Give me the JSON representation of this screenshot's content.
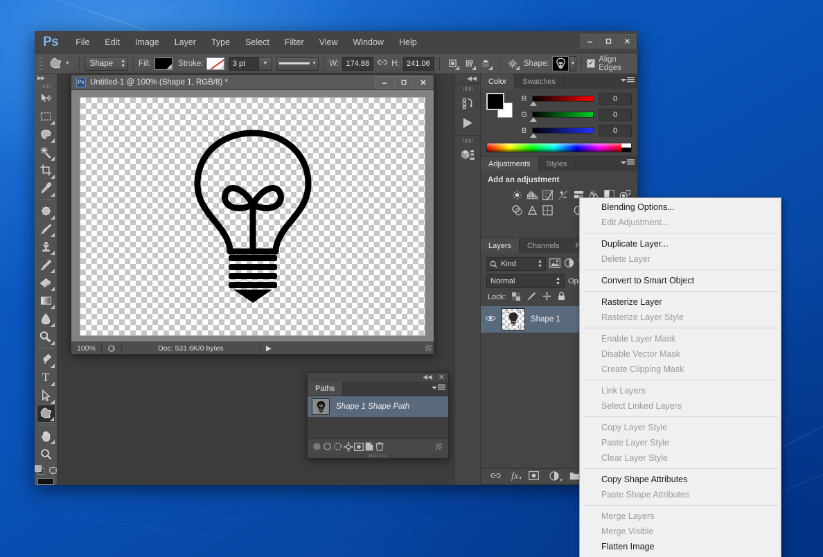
{
  "app": {
    "logo": "Ps",
    "menus": [
      "File",
      "Edit",
      "Image",
      "Layer",
      "Type",
      "Select",
      "Filter",
      "View",
      "Window",
      "Help"
    ],
    "window_controls": {
      "minimize": "–",
      "maximize": "☐",
      "close": "✕"
    }
  },
  "options_bar": {
    "tool_icon": "custom-shape-icon",
    "mode_value": "Shape",
    "fill_label": "Fill:",
    "fill_color": "#000000",
    "stroke_label": "Stroke:",
    "stroke_color": "none",
    "stroke_width": "3 pt",
    "line_style": "solid-line",
    "w_label": "W:",
    "w_value": "174.88 ",
    "link_icon": "link-icon",
    "h_label": "H:",
    "h_value": "241.06 ",
    "path_ops_icon": "path-operations-icon",
    "path_align_icon": "path-alignment-icon",
    "path_arrange_icon": "path-arrangement-icon",
    "gear_icon": "gear-icon",
    "shape_label": "Shape:",
    "shape_preview": "lightbulb-icon",
    "align_edges_label": "Align Edges",
    "align_edges_checked": true
  },
  "toolbox": {
    "tools": [
      {
        "name": "move-tool",
        "glyph": "move"
      },
      {
        "name": "rectangular-marquee-tool",
        "glyph": "marquee"
      },
      {
        "name": "lasso-tool",
        "glyph": "lasso"
      },
      {
        "name": "quick-selection-tool",
        "glyph": "wand"
      },
      {
        "name": "crop-tool",
        "glyph": "crop"
      },
      {
        "name": "eyedropper-tool",
        "glyph": "eyedropper"
      },
      {
        "name": "spot-healing-brush-tool",
        "glyph": "healing"
      },
      {
        "name": "brush-tool",
        "glyph": "brush"
      },
      {
        "name": "clone-stamp-tool",
        "glyph": "stamp"
      },
      {
        "name": "history-brush-tool",
        "glyph": "historybrush"
      },
      {
        "name": "eraser-tool",
        "glyph": "eraser"
      },
      {
        "name": "gradient-tool",
        "glyph": "gradient"
      },
      {
        "name": "blur-tool",
        "glyph": "blur"
      },
      {
        "name": "dodge-tool",
        "glyph": "dodge"
      },
      {
        "name": "pen-tool",
        "glyph": "pen"
      },
      {
        "name": "horizontal-type-tool",
        "glyph": "type"
      },
      {
        "name": "path-selection-tool",
        "glyph": "pathselect"
      },
      {
        "name": "custom-shape-tool",
        "glyph": "customshape",
        "active": true
      },
      {
        "name": "hand-tool",
        "glyph": "hand"
      },
      {
        "name": "zoom-tool",
        "glyph": "zoom"
      }
    ],
    "foreground_color": "#000000",
    "background_color": "#ffffff"
  },
  "document": {
    "title": "Untitled-1 @ 100% (Shape 1, RGB/8) *",
    "icon": "ps-document-icon",
    "controls": {
      "minimize": "–",
      "maximize": "☐",
      "close": "✕"
    },
    "artwork": "lightbulb-shape",
    "status": {
      "zoom": "100%",
      "doc_icon": "document-info-icon",
      "doc_size": "Doc: 531.6K/0 bytes",
      "arrow": "▶"
    }
  },
  "paths_panel": {
    "collapse_icon": "collapse-icon",
    "close_icon": "close-icon",
    "tabs": [
      {
        "label": "Paths",
        "active": true
      }
    ],
    "menu_icon": "panel-menu-icon",
    "rows": [
      {
        "name": "Shape 1 Shape Path",
        "thumb": "lightbulb-path-thumb",
        "selected": true
      }
    ],
    "footer_icons": [
      "fill-path-icon",
      "stroke-path-icon",
      "load-selection-icon",
      "make-work-path-icon",
      "add-layer-mask-icon",
      "new-path-icon",
      "delete-path-icon"
    ]
  },
  "mini_dock": {
    "collapse_icon": "collapse-dock-icon",
    "icons": [
      "history-icon",
      "actions-play-icon",
      "3d-icon"
    ]
  },
  "color_panel": {
    "tabs": [
      {
        "label": "Color",
        "active": true
      },
      {
        "label": "Swatches",
        "active": false
      }
    ],
    "menu_icon": "panel-menu-icon",
    "foreground": "#000000",
    "background": "#ffffff",
    "channels": [
      {
        "label": "R",
        "value": "0"
      },
      {
        "label": "G",
        "value": "0"
      },
      {
        "label": "B",
        "value": "0"
      }
    ]
  },
  "adjustments_panel": {
    "tabs": [
      {
        "label": "Adjustments",
        "active": true
      },
      {
        "label": "Styles",
        "active": false
      }
    ],
    "menu_icon": "panel-menu-icon",
    "heading": "Add an adjustment",
    "icons": [
      "brightness-contrast-icon",
      "levels-icon",
      "curves-icon",
      "exposure-icon",
      "vibrance-icon",
      "hue-saturation-icon",
      "color-balance-icon",
      "black-white-icon",
      "photo-filter-icon",
      "channel-mixer-icon",
      "color-lookup-icon",
      "invert-icon",
      "posterize-icon",
      "threshold-icon",
      "gradient-map-icon",
      "selective-color-icon"
    ]
  },
  "layers_panel": {
    "tabs": [
      {
        "label": "Layers",
        "active": true
      },
      {
        "label": "Channels",
        "active": false
      },
      {
        "label": "Paths",
        "active": false
      }
    ],
    "menu_icon": "panel-menu-icon",
    "filter_label": "Kind",
    "filter_icon": "search-icon",
    "filter_type_icons": [
      "pixel-filter-icon",
      "adjustment-filter-icon",
      "type-filter-icon"
    ],
    "blend_mode": "Normal",
    "opacity_label": "Opa",
    "lock_label": "Lock:",
    "lock_icons": [
      "lock-transparent-pixels-icon",
      "lock-image-pixels-icon",
      "lock-position-icon",
      "lock-all-icon"
    ],
    "layers": [
      {
        "name": "Shape 1",
        "visible": true,
        "selected": true,
        "eye_icon": "eye-icon",
        "thumb": "shape-layer-thumb"
      }
    ],
    "footer_icons": [
      "link-layers-icon",
      "layer-style-fx-icon",
      "add-layer-mask-icon",
      "new-adjustment-layer-icon",
      "new-group-icon"
    ]
  },
  "context_menu": {
    "items": [
      {
        "label": "Blending Options...",
        "enabled": true
      },
      {
        "label": "Edit Adjustment...",
        "enabled": false
      },
      {
        "separator": true
      },
      {
        "label": "Duplicate Layer...",
        "enabled": true
      },
      {
        "label": "Delete Layer",
        "enabled": false
      },
      {
        "separator": true
      },
      {
        "label": "Convert to Smart Object",
        "enabled": true
      },
      {
        "separator": true
      },
      {
        "label": "Rasterize Layer",
        "enabled": true
      },
      {
        "label": "Rasterize Layer Style",
        "enabled": false
      },
      {
        "separator": true
      },
      {
        "label": "Enable Layer Mask",
        "enabled": false
      },
      {
        "label": "Disable Vector Mask",
        "enabled": false
      },
      {
        "label": "Create Clipping Mask",
        "enabled": false
      },
      {
        "separator": true
      },
      {
        "label": "Link Layers",
        "enabled": false
      },
      {
        "label": "Select Linked Layers",
        "enabled": false
      },
      {
        "separator": true
      },
      {
        "label": "Copy Layer Style",
        "enabled": false
      },
      {
        "label": "Paste Layer Style",
        "enabled": false
      },
      {
        "label": "Clear Layer Style",
        "enabled": false
      },
      {
        "separator": true
      },
      {
        "label": "Copy Shape Attributes",
        "enabled": true
      },
      {
        "label": "Paste Shape Attributes",
        "enabled": false
      },
      {
        "separator": true
      },
      {
        "label": "Merge Layers",
        "enabled": false
      },
      {
        "label": "Merge Visible",
        "enabled": false
      },
      {
        "label": "Flatten Image",
        "enabled": true
      }
    ]
  },
  "colors": {
    "desktop": "#0a56bd",
    "panel_bg": "#454545",
    "menu_bg": "#444444",
    "selection_blue": "#5a6a7d",
    "context_menu_bg": "#f0f0f0"
  }
}
